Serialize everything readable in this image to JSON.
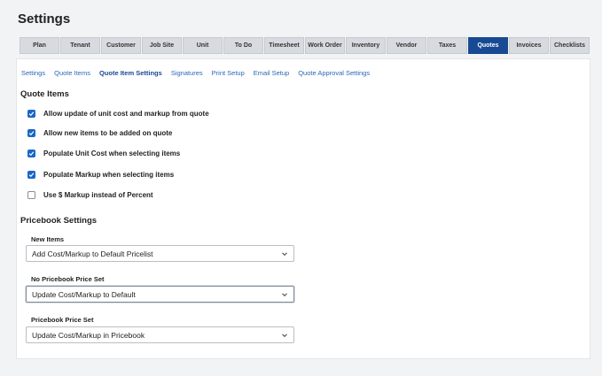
{
  "page": {
    "title": "Settings"
  },
  "tabs": [
    {
      "label": "Plan"
    },
    {
      "label": "Tenant"
    },
    {
      "label": "Customer"
    },
    {
      "label": "Job Site"
    },
    {
      "label": "Unit"
    },
    {
      "label": "To Do"
    },
    {
      "label": "Timesheet"
    },
    {
      "label": "Work Order"
    },
    {
      "label": "Inventory"
    },
    {
      "label": "Vendor"
    },
    {
      "label": "Taxes"
    },
    {
      "label": "Quotes"
    },
    {
      "label": "Invoices"
    },
    {
      "label": "Checklists"
    }
  ],
  "active_tab": "Quotes",
  "subnav": [
    {
      "label": "Settings"
    },
    {
      "label": "Quote Items"
    },
    {
      "label": "Quote Item Settings"
    },
    {
      "label": "Signatures"
    },
    {
      "label": "Print Setup"
    },
    {
      "label": "Email Setup"
    },
    {
      "label": "Quote Approval Settings"
    }
  ],
  "active_subnav": "Quote Item Settings",
  "quote_items": {
    "title": "Quote Items",
    "options": [
      {
        "label": "Allow update of unit cost and markup from quote",
        "checked": true
      },
      {
        "label": "Allow new items to be added on quote",
        "checked": true
      },
      {
        "label": "Populate Unit Cost when selecting items",
        "checked": true
      },
      {
        "label": "Populate Markup when selecting items",
        "checked": true
      },
      {
        "label": "Use $ Markup instead of Percent",
        "checked": false
      }
    ]
  },
  "pricebook": {
    "title": "Pricebook Settings",
    "fields": [
      {
        "label": "New Items",
        "value": "Add Cost/Markup to Default Pricelist"
      },
      {
        "label": "No Pricebook Price Set",
        "value": "Update Cost/Markup to Default"
      },
      {
        "label": "Pricebook Price Set",
        "value": "Update Cost/Markup in Pricebook"
      }
    ]
  },
  "colors": {
    "accent": "#174a93",
    "checkbox": "#1a66c9",
    "link": "#2a67b8"
  }
}
